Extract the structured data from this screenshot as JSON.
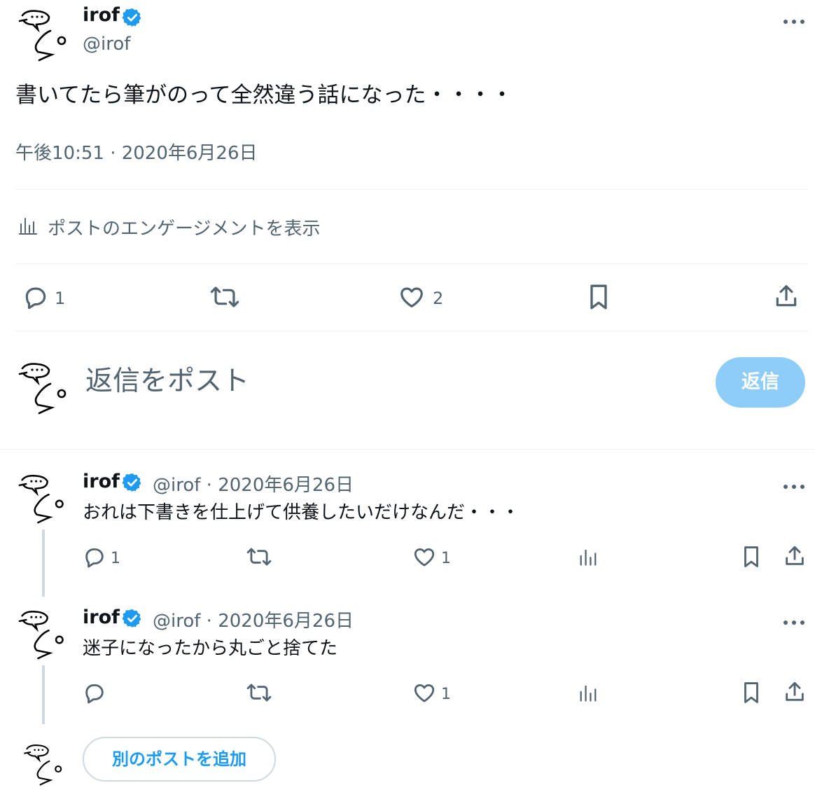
{
  "colors": {
    "accent": "#1d9bf0",
    "muted": "#536471",
    "text": "#0f1419",
    "divider": "#eff3f4",
    "reply_button_bg": "#8ecdf8"
  },
  "main_post": {
    "display_name": "irof",
    "handle": "@irof",
    "text": "書いてたら筆がのって全然違う話になった・・・・",
    "timestamp": "午後10:51 · 2020年6月26日",
    "engagement_link": "ポストのエンゲージメントを表示",
    "actions": {
      "reply_count": "1",
      "retweet_count": "",
      "like_count": "2"
    }
  },
  "composer": {
    "placeholder": "返信をポスト",
    "reply_button": "返信"
  },
  "thread": [
    {
      "display_name": "irof",
      "meta": "@irof · 2020年6月26日",
      "text": "おれは下書きを仕上げて供養したいだけなんだ・・・",
      "reply_count": "1",
      "retweet_count": "",
      "like_count": "1"
    },
    {
      "display_name": "irof",
      "meta": "@irof · 2020年6月26日",
      "text": "迷子になったから丸ごと捨てた",
      "reply_count": "",
      "retweet_count": "",
      "like_count": "1"
    }
  ],
  "add_post_button": "別のポストを追加"
}
